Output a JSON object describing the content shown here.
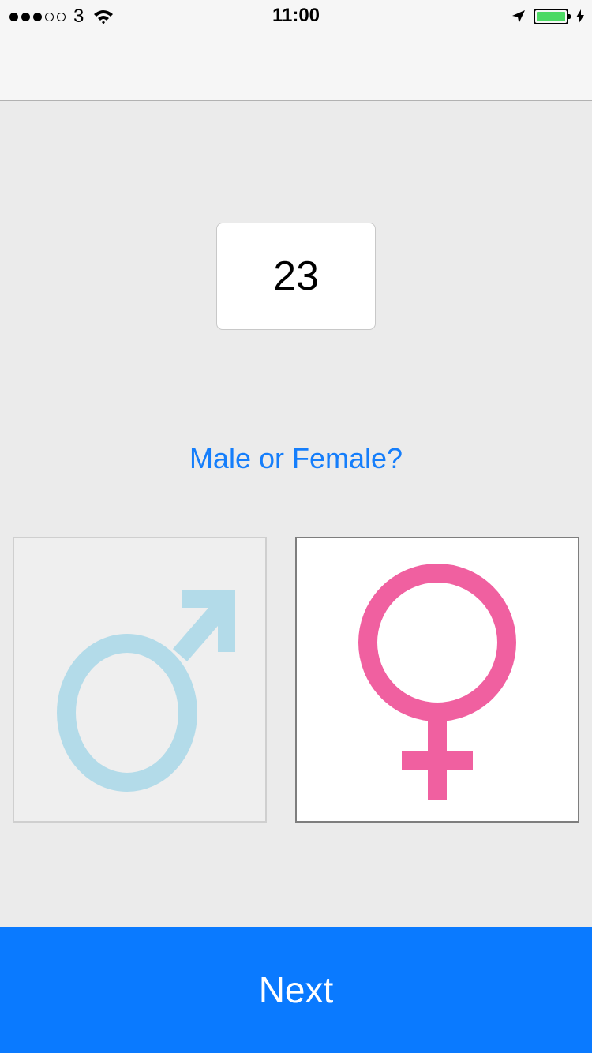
{
  "status_bar": {
    "signal_bars_filled": 3,
    "signal_bars_total": 5,
    "carrier": "3",
    "time": "11:00",
    "battery_level": 1.0
  },
  "age": {
    "value": "23"
  },
  "gender_prompt": "Male or Female?",
  "gender_options": [
    {
      "id": "male",
      "icon": "male-symbol-icon",
      "color": "#b3dbe9",
      "selected": false
    },
    {
      "id": "female",
      "icon": "female-symbol-icon",
      "color": "#f060a0",
      "selected": true
    }
  ],
  "footer": {
    "next_label": "Next",
    "color": "#0a7aff"
  },
  "colors": {
    "accent": "#157efb",
    "background": "#ebebeb"
  }
}
